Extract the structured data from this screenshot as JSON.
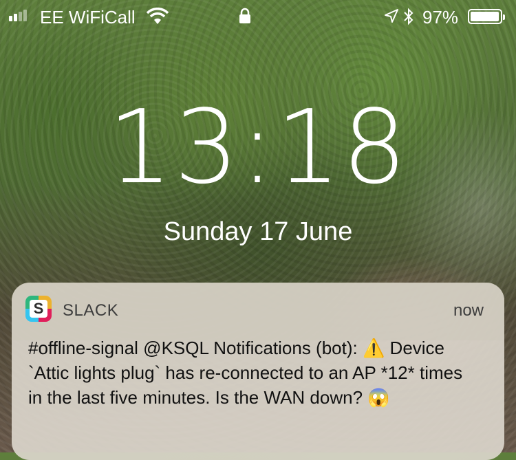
{
  "status_bar": {
    "carrier": "EE WiFiCall",
    "battery_percent": "97%",
    "battery_level": 0.97,
    "icons": [
      "signal-icon",
      "wifi-icon",
      "lock-icon",
      "location-arrow-icon",
      "bluetooth-icon",
      "battery-icon"
    ]
  },
  "lock_screen": {
    "time": "13:18",
    "date": "Sunday 17 June"
  },
  "notification": {
    "app_name": "SLACK",
    "app_icon_letter": "S",
    "time": "now",
    "message": "#offline-signal @KSQL Notifications (bot): ⚠️ Device `Attic lights plug` has re-connected to an AP *12* times in the last five minutes. Is the WAN down? 😱"
  }
}
